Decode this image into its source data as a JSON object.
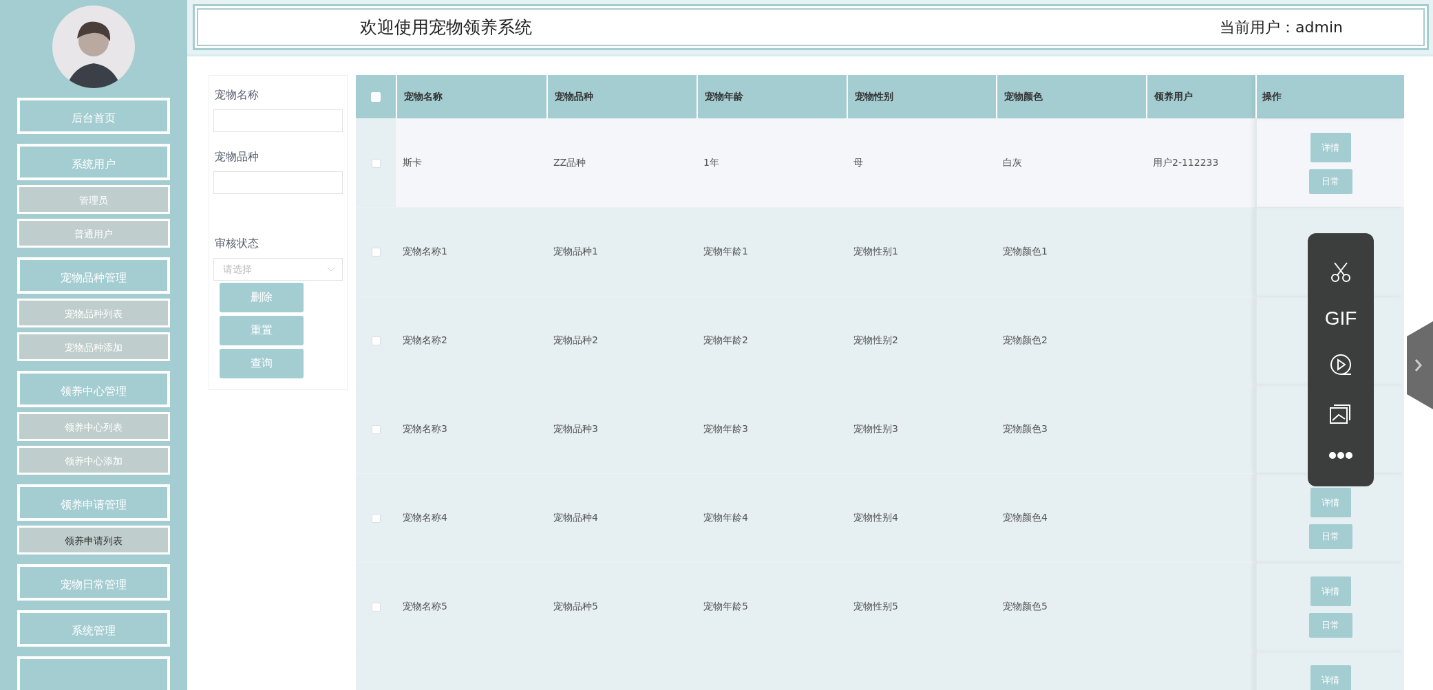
{
  "header": {
    "title": "欢迎使用宠物领养系统",
    "user": "当前用户：admin"
  },
  "sidebar": {
    "items": [
      {
        "label": "后台首页",
        "kind": "group",
        "selected": false
      },
      {
        "label": "系统用户",
        "kind": "group",
        "selected": false
      },
      {
        "label": "管理员",
        "kind": "sub",
        "selected": false
      },
      {
        "label": "普通用户",
        "kind": "sub",
        "selected": false
      },
      {
        "label": "宠物品种管理",
        "kind": "group",
        "selected": false
      },
      {
        "label": "宠物品种列表",
        "kind": "sub",
        "selected": false
      },
      {
        "label": "宠物品种添加",
        "kind": "sub",
        "selected": false
      },
      {
        "label": "领养中心管理",
        "kind": "group",
        "selected": false
      },
      {
        "label": "领养中心列表",
        "kind": "sub",
        "selected": false
      },
      {
        "label": "领养中心添加",
        "kind": "sub",
        "selected": false
      },
      {
        "label": "领养申请管理",
        "kind": "group",
        "selected": false
      },
      {
        "label": "领养申请列表",
        "kind": "sub",
        "selected": true
      },
      {
        "label": "宠物日常管理",
        "kind": "group",
        "selected": false
      },
      {
        "label": "系统管理",
        "kind": "group",
        "selected": false
      },
      {
        "kind": "group"
      }
    ]
  },
  "filters": {
    "fields": [
      {
        "label": "宠物名称",
        "kind": "text"
      },
      {
        "label": "宠物品种",
        "kind": "text"
      },
      {
        "label": "审核状态",
        "kind": "select",
        "placeholder": "请选择"
      }
    ],
    "buttons": [
      "删除",
      "重置",
      "查询"
    ]
  },
  "table": {
    "select_all": {
      "checked": false
    },
    "columns": [
      "宠物名称",
      "宠物品种",
      "宠物年龄",
      "宠物性别",
      "宠物颜色",
      "领养用户",
      "操作"
    ],
    "rows": [
      {
        "checked": false,
        "highlighted": true,
        "cells": [
          "斯卡",
          "ZZ品种",
          "1年",
          "母",
          "白灰",
          "用户2-112233"
        ],
        "actions": [
          "详情",
          "日常"
        ]
      },
      {
        "checked": false,
        "highlighted": false,
        "cells": [
          "宠物名称1",
          "宠物品种1",
          "宠物年龄1",
          "宠物性别1",
          "宠物颜色1",
          ""
        ]
      },
      {
        "checked": false,
        "highlighted": false,
        "cells": [
          "宠物名称2",
          "宠物品种2",
          "宠物年龄2",
          "宠物性别2",
          "宠物颜色2",
          ""
        ]
      },
      {
        "checked": false,
        "highlighted": false,
        "cells": [
          "宠物名称3",
          "宠物品种3",
          "宠物年龄3",
          "宠物性别3",
          "宠物颜色3",
          ""
        ]
      },
      {
        "checked": false,
        "highlighted": false,
        "cells": [
          "宠物名称4",
          "宠物品种4",
          "宠物年龄4",
          "宠物性别4",
          "宠物颜色4",
          ""
        ],
        "actions": [
          "详情",
          "日常"
        ]
      },
      {
        "checked": false,
        "highlighted": false,
        "cells": [
          "宠物名称5",
          "宠物品种5",
          "宠物年龄5",
          "宠物性别5",
          "宠物颜色5",
          ""
        ],
        "actions": [
          "详情",
          "日常"
        ]
      },
      {
        "actions": [
          "详情"
        ]
      }
    ]
  },
  "capture_toolbar": {
    "tools": [
      {
        "kind": "scissors"
      },
      {
        "kind": "gif",
        "label": "GIF"
      },
      {
        "kind": "record"
      },
      {
        "kind": "screenshots"
      },
      {
        "kind": "more"
      }
    ]
  }
}
